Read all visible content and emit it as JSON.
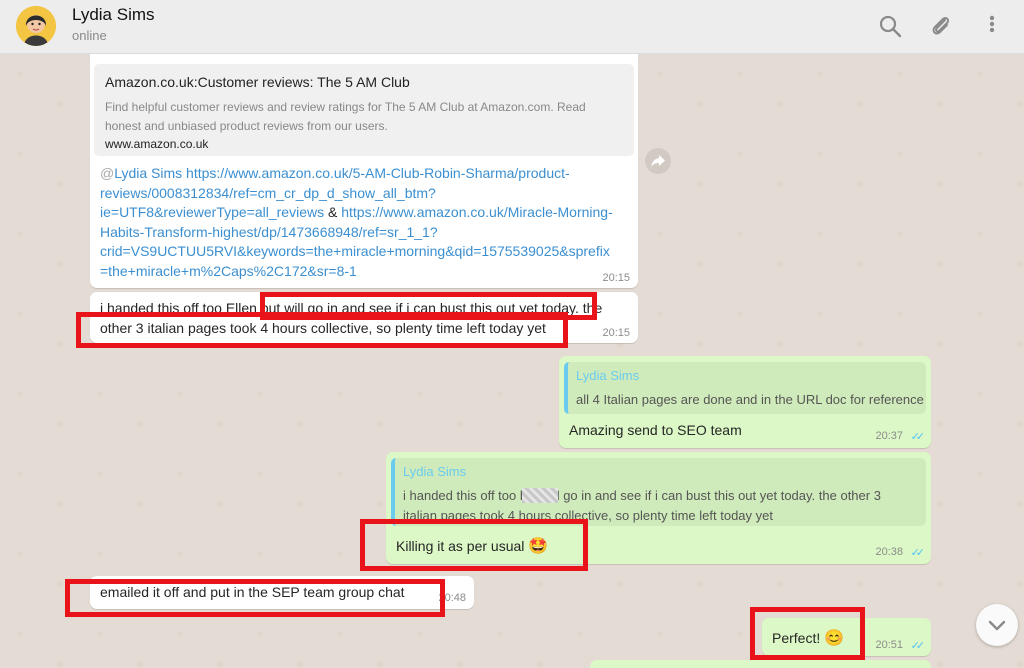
{
  "header": {
    "name": "Lydia Sims",
    "status": "online"
  },
  "colors": {
    "accent": "#6bcbef",
    "outgoing": "#dcf8c6",
    "incoming": "#ffffff",
    "highlight": "#e8141a",
    "link": "#3b8fd0"
  },
  "preview": {
    "title": "Amazon.co.uk:Customer reviews: The 5 AM Club",
    "desc1": "Find helpful customer reviews and review ratings for The 5 AM Club at Amazon.com. Read",
    "desc2": "honest and unbiased product reviews from our users.",
    "domain": "www.amazon.co.uk",
    "mention": "@",
    "mention_name": "Lydia Sims",
    "link_line1": " https://www.amazon.co.uk/5-AM-Club-Robin-Sharma/product-",
    "link_line2": "reviews/0008312834/ref=cm_cr_dp_d_show_all_btm?",
    "link_line3a": "ie=UTF8&reviewerType=all_reviews",
    "amp": " & ",
    "link_line3b": "https://www.amazon.co.uk/Miracle-Morning-",
    "link_line4": "Habits-Transform-highest/dp/1473668948/ref=sr_1_1?",
    "link_line5": "crid=VS9UCTUU5RVI&keywords=the+miracle+morning&qid=1575539025&sprefix",
    "link_line6": "=the+miracle+m%2Caps%2C172&sr=8-1",
    "time": "20:15"
  },
  "msg_handed": {
    "line1": "i handed this off too Ellen but will go in and see if i can bust this out yet today. the",
    "line2": "other 3 italian pages took 4 hours collective, so plenty time left today yet",
    "time": "20:15"
  },
  "msg_amazing": {
    "quote_name": "Lydia Sims",
    "quote_text": "all 4 Italian pages are done and in the URL doc for reference",
    "text": "Amazing send to SEO team",
    "time": "20:37"
  },
  "msg_killing": {
    "quote_name": "Lydia Sims",
    "quote_line1": "i handed this off too        but will go in and see if i can bust this out yet today. the other 3",
    "quote_line2": "italian pages took 4 hours collective, so plenty time left today yet",
    "text": "Killing it as per usual",
    "emoji": "🤩",
    "time": "20:38"
  },
  "msg_emailed": {
    "text": "emailed it off and put in the SEP team group chat",
    "time": "20:48"
  },
  "msg_perfect": {
    "text": "Perfect!",
    "emoji": "😊",
    "time": "20:51"
  },
  "icons": {
    "search": "search-icon",
    "attach": "paperclip-icon",
    "menu": "more-vertical-icon",
    "forward": "forward-icon",
    "scroll": "chevron-down-icon"
  }
}
